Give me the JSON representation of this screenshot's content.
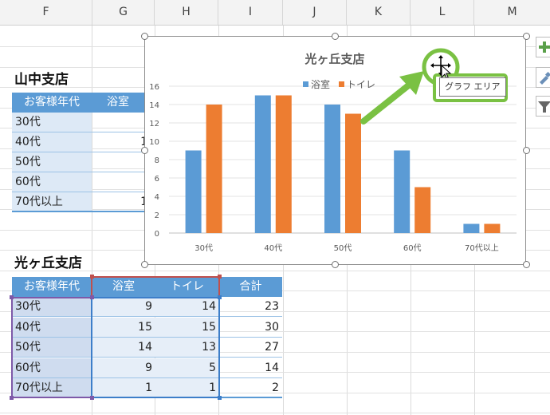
{
  "columns": [
    "F",
    "G",
    "H",
    "I",
    "J",
    "K",
    "L",
    "M"
  ],
  "yamanaka": {
    "title": "山中支店",
    "headers": [
      "お客様年代",
      "浴室"
    ],
    "rows": [
      {
        "label": "30代",
        "value": ""
      },
      {
        "label": "40代",
        "value": "1"
      },
      {
        "label": "50代",
        "value": ""
      },
      {
        "label": "60代",
        "value": ""
      },
      {
        "label": "70代以上",
        "value": "1"
      }
    ]
  },
  "hikarigaoka": {
    "title": "光ヶ丘支店",
    "headers": [
      "お客様年代",
      "浴室",
      "トイレ",
      "合計"
    ],
    "rows": [
      {
        "label": "30代",
        "bath": "9",
        "toilet": "14",
        "total": "23"
      },
      {
        "label": "40代",
        "bath": "15",
        "toilet": "15",
        "total": "30"
      },
      {
        "label": "50代",
        "bath": "14",
        "toilet": "13",
        "total": "27"
      },
      {
        "label": "60代",
        "bath": "9",
        "toilet": "5",
        "total": "14"
      },
      {
        "label": "70代以上",
        "bath": "1",
        "toilet": "1",
        "total": "2"
      }
    ]
  },
  "chart_data": {
    "type": "bar",
    "title": "光ヶ丘支店",
    "categories": [
      "30代",
      "40代",
      "50代",
      "60代",
      "70代以上"
    ],
    "series": [
      {
        "name": "浴室",
        "values": [
          9,
          15,
          14,
          9,
          1
        ],
        "color": "#5b9bd5"
      },
      {
        "name": "トイレ",
        "values": [
          14,
          15,
          13,
          5,
          1
        ],
        "color": "#ed7d31"
      }
    ],
    "ylim": [
      0,
      16
    ],
    "yticks": [
      0,
      2,
      4,
      6,
      8,
      10,
      12,
      14,
      16
    ],
    "grid": true,
    "legend": "top"
  },
  "tooltip": "グラフ エリア",
  "colors": {
    "highlight": "#7ac143",
    "header": "#5b9bd5"
  },
  "side_icons": [
    "plus-icon",
    "brush-icon",
    "filter-icon"
  ]
}
